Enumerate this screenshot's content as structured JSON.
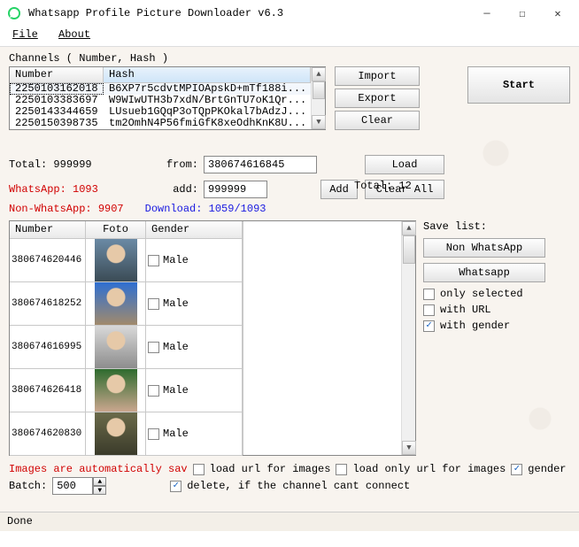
{
  "window": {
    "title": "Whatsapp Profile Picture Downloader v6.3"
  },
  "menu": {
    "file": "File",
    "about": "About"
  },
  "channels": {
    "title": "Channels ( Number, Hash )",
    "cols": {
      "number": "Number",
      "hash": "Hash"
    },
    "rows": [
      {
        "number": "2250103162018",
        "hash": "B6XP7r5cdvtMPIOApskD+mTf188i..."
      },
      {
        "number": "2250103383697",
        "hash": "W9WIwUTH3b7xdN/BrtGnTU7oK1Qr..."
      },
      {
        "number": "2250143344659",
        "hash": "LUsueb1GQqP3oTQpPKOkal7bAdzJ..."
      },
      {
        "number": "2250150398735",
        "hash": "tm2OmhN4P56fmiGfK8xeOdhKnK8U..."
      }
    ],
    "buttons": {
      "import": "Import",
      "export": "Export",
      "clear": "Clear"
    },
    "total_label": "Total:",
    "total_value": "12"
  },
  "start": "Start",
  "params": {
    "total_label": "Total:",
    "total_value": "999999",
    "from_label": "from:",
    "from_value": "380674616845",
    "load": "Load",
    "whatsapp_label": "WhatsApp:",
    "whatsapp_value": "1093",
    "add_label": "add:",
    "add_value": "999999",
    "add_btn": "Add",
    "clear_all": "Clear All",
    "nonwa_label": "Non-WhatsApp:",
    "nonwa_value": "9907",
    "download_label": "Download:",
    "download_value": "1059/1093"
  },
  "results": {
    "cols": {
      "number": "Number",
      "foto": "Foto",
      "gender": "Gender"
    },
    "rows": [
      {
        "number": "380674620446",
        "gender": "Male",
        "fc1": "#6b8aa5",
        "fc2": "#3b4b55"
      },
      {
        "number": "380674618252",
        "gender": "Male",
        "fc1": "#2f6fd1",
        "fc2": "#a18a6c"
      },
      {
        "number": "380674616995",
        "gender": "Male",
        "fc1": "#d9d9d9",
        "fc2": "#8d8d8d"
      },
      {
        "number": "380674626418",
        "gender": "Male",
        "fc1": "#2e6b2e",
        "fc2": "#caa68e"
      },
      {
        "number": "380674620830",
        "gender": "Male",
        "fc1": "#6b6b4a",
        "fc2": "#3b3b2a"
      }
    ]
  },
  "save": {
    "title": "Save list:",
    "non_wa": "Non WhatsApp",
    "wa": "Whatsapp",
    "only_selected": "only selected",
    "with_url": "with URL",
    "with_gender": "with gender"
  },
  "bottom": {
    "auto_save": "Images are automatically sav",
    "load_url": "load url for images",
    "load_only_url": "load only url for images",
    "gender": "gender",
    "batch_label": "Batch:",
    "batch_value": "500",
    "delete_cant": "delete, if the channel cant connect"
  },
  "status": "Done"
}
